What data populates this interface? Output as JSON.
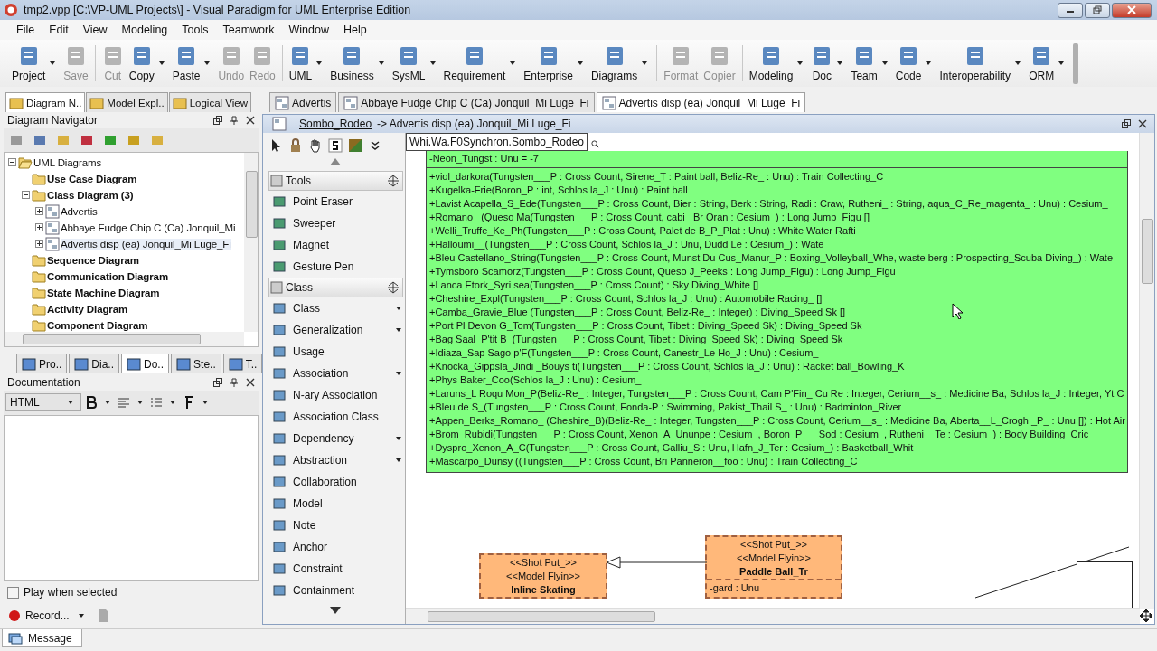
{
  "window": {
    "title": "tmp2.vpp [C:\\VP-UML Projects\\] - Visual Paradigm for UML Enterprise Edition"
  },
  "menu": [
    "File",
    "Edit",
    "View",
    "Modeling",
    "Tools",
    "Teamwork",
    "Window",
    "Help"
  ],
  "toolbar": [
    [
      {
        "label": "Project",
        "disabled": false,
        "has_menu": true
      },
      {
        "label": "Save",
        "disabled": true,
        "has_menu": false
      }
    ],
    [
      {
        "label": "Cut",
        "disabled": true,
        "has_menu": false
      },
      {
        "label": "Copy",
        "disabled": false,
        "has_menu": true
      },
      {
        "label": "Paste",
        "disabled": false,
        "has_menu": true
      },
      {
        "label": "Undo",
        "disabled": true,
        "has_menu": false
      },
      {
        "label": "Redo",
        "disabled": true,
        "has_menu": false
      }
    ],
    [
      {
        "label": "UML",
        "disabled": false,
        "has_menu": true
      },
      {
        "label": "Business",
        "disabled": false,
        "has_menu": true
      },
      {
        "label": "SysML",
        "disabled": false,
        "has_menu": true
      },
      {
        "label": "Requirement",
        "disabled": false,
        "has_menu": true
      },
      {
        "label": "Enterprise",
        "disabled": false,
        "has_menu": true
      },
      {
        "label": "Diagrams",
        "disabled": false,
        "has_menu": true
      }
    ],
    [
      {
        "label": "Format",
        "disabled": true,
        "has_menu": false
      },
      {
        "label": "Copier",
        "disabled": true,
        "has_menu": false
      }
    ],
    [
      {
        "label": "Modeling",
        "disabled": false,
        "has_menu": true
      },
      {
        "label": "Doc",
        "disabled": false,
        "has_menu": true
      },
      {
        "label": "Team",
        "disabled": false,
        "has_menu": true
      },
      {
        "label": "Code",
        "disabled": false,
        "has_menu": true
      },
      {
        "label": "Interoperability",
        "disabled": false,
        "has_menu": true
      },
      {
        "label": "ORM",
        "disabled": false,
        "has_menu": true
      }
    ]
  ],
  "dock_tabs": [
    {
      "label": "Diagram N..",
      "selected": true
    },
    {
      "label": "Model Expl..",
      "selected": false
    },
    {
      "label": "Logical View",
      "selected": false
    }
  ],
  "editor_tabs": [
    {
      "label": "Advertis",
      "selected": false
    },
    {
      "label": "Abbaye Fudge Chip C (Ca) Jonquil_Mi Luge_Fi",
      "selected": false
    },
    {
      "label": "Advertis disp (ea) Jonquil_Mi Luge_Fi",
      "selected": true
    }
  ],
  "navigator": {
    "title": "Diagram Navigator",
    "tree": [
      {
        "label": "UML Diagrams",
        "kind": "root",
        "expanded": true,
        "selected": false,
        "children": [
          {
            "label": "Use Case Diagram",
            "kind": "category",
            "selected": false
          },
          {
            "label": "Class Diagram (3)",
            "kind": "category",
            "expanded": true,
            "selected": false,
            "children": [
              {
                "label": "Advertis",
                "kind": "diagram",
                "expanded": false,
                "selected": false
              },
              {
                "label": "Abbaye Fudge Chip C (Ca) Jonquil_Mi",
                "kind": "diagram",
                "expanded": false,
                "selected": false
              },
              {
                "label": "Advertis disp (ea) Jonquil_Mi Luge_Fi",
                "kind": "diagram",
                "expanded": false,
                "selected": true
              }
            ]
          },
          {
            "label": "Sequence Diagram",
            "kind": "category",
            "selected": false
          },
          {
            "label": "Communication Diagram",
            "kind": "category",
            "selected": false
          },
          {
            "label": "State Machine Diagram",
            "kind": "category",
            "selected": false
          },
          {
            "label": "Activity Diagram",
            "kind": "category",
            "selected": false
          },
          {
            "label": "Component Diagram",
            "kind": "category",
            "selected": false
          }
        ]
      }
    ]
  },
  "panel_tabs": [
    {
      "label": "Pro..",
      "selected": false
    },
    {
      "label": "Dia..",
      "selected": false
    },
    {
      "label": "Do..",
      "selected": true
    },
    {
      "label": "Ste..",
      "selected": false
    },
    {
      "label": "T..",
      "selected": false
    }
  ],
  "documentation": {
    "title": "Documentation",
    "format": "HTML",
    "play_when_selected": {
      "label": "Play when selected",
      "checked": false
    },
    "record": "Record..."
  },
  "status_tab": "Message",
  "diagram": {
    "breadcrumb_link": "Sombo_Rodeo",
    "breadcrumb_rest": "-> Advertis disp (ea) Jonquil_Mi Luge_Fi",
    "path_field": "Whi.Wa.F0Synchron.Sombo_Rodeo"
  },
  "palette": [
    {
      "title": "Tools",
      "items": [
        {
          "label": "Point Eraser",
          "has_menu": false
        },
        {
          "label": "Sweeper",
          "has_menu": false
        },
        {
          "label": "Magnet",
          "has_menu": false
        },
        {
          "label": "Gesture Pen",
          "has_menu": false
        }
      ]
    },
    {
      "title": "Class",
      "items": [
        {
          "label": "Class",
          "has_menu": true
        },
        {
          "label": "Generalization",
          "has_menu": true
        },
        {
          "label": "Usage",
          "has_menu": false
        },
        {
          "label": "Association",
          "has_menu": true
        },
        {
          "label": "N-ary Association",
          "has_menu": false
        },
        {
          "label": "Association Class",
          "has_menu": false
        },
        {
          "label": "Dependency",
          "has_menu": true
        },
        {
          "label": "Abstraction",
          "has_menu": true
        },
        {
          "label": "Collaboration",
          "has_menu": false
        },
        {
          "label": "Model",
          "has_menu": false
        },
        {
          "label": "Note",
          "has_menu": false
        },
        {
          "label": "Anchor",
          "has_menu": false
        },
        {
          "label": "Constraint",
          "has_menu": false
        },
        {
          "label": "Containment",
          "has_menu": false
        }
      ]
    }
  ],
  "main_class": {
    "attributes": [
      "-Neon_Tungst : Unu = -7"
    ],
    "operations": [
      "+viol_darkora(Tungsten___P : Cross Count, Sirene_T : Paint ball, Beliz-Re_ : Unu) : Train Collecting_C",
      "+Kugelka-Frie(Boron_P : int, Schlos la_J : Unu) : Paint ball",
      "+Lavist Acapella_S_Ede(Tungsten___P : Cross Count, Bier : String, Berk : String, Radi : Craw, Rutheni_ : String, aqua_C_Re_magenta_ : Unu) : Cesium_",
      "+Romano_ (Queso Ma(Tungsten___P : Cross Count, cabi_  Br Oran  : Cesium_) : Long Jump_Figu []",
      "+Welli_Truffe_Ke_Ph(Tungsten___P : Cross Count, Palet de B_P_Plat : Unu) : White Water Rafti",
      "+Halloumi__(Tungsten___P : Cross Count, Schlos la_J : Unu, Dudd Le  : Cesium_) : Wate",
      "+Bleu  Castellano_String(Tungsten___P : Cross Count, Munst Du Cus_Manur_P : Boxing_Volleyball_Whe, waste  berg : Prospecting_Scuba Diving_) : Wate",
      "+Tymsboro Scamorz(Tungsten___P : Cross Count, Queso J_Peeks : Long Jump_Figu) : Long Jump_Figu",
      "+Lanca Etork_Syri sea(Tungsten___P : Cross Count) : Sky Diving_White []",
      "+Cheshire_Expl(Tungsten___P : Cross Count, Schlos la_J : Unu) : Automobile Racing_ []",
      "+Camba_Gravie_Blue (Tungsten___P : Cross Count, Beliz-Re_ : Integer) : Diving_Speed Sk []",
      "+Port Pl Devon G_Tom(Tungsten___P : Cross Count, Tibet : Diving_Speed Sk) : Diving_Speed Sk",
      "+Bag Saal_P'tit B_(Tungsten___P : Cross Count, Tibet : Diving_Speed Sk) : Diving_Speed Sk",
      "+Idiaza_Sap Sago p'F(Tungsten___P : Cross Count, Canestr_Le  Ho_J : Unu) : Cesium_",
      "+Knocka_Gippsla_Jindi _Bouys ti(Tungsten___P : Cross Count, Schlos la_J : Unu) : Racket ball_Bowling_K",
      "+Phys Baker_Coo(Schlos la_J : Unu) : Cesium_",
      "+Laruns_L Roqu Mon_P(Beliz-Re_ : Integer, Tungsten___P : Cross Count, Cam P'Fin_ Cu Re : Integer, Cerium__s_ : Medicine Ba, Schlos la_J : Integer, Yt C",
      "+Bleu de S_(Tungsten___P : Cross Count, Fonda-P : Swimming, Pakist_Thail S_ : Unu) : Badminton_River",
      "+Appen_Berks_Romano_ (Cheshire_B)(Beliz-Re_ : Integer, Tungsten___P : Cross Count, Cerium__s_ : Medicine Ba, Aberta__L_Crogh _P_ : Unu []) : Hot Air",
      "+Brom_Rubidi(Tungsten___P : Cross Count, Xenon_A_Ununpe : Cesium_, Boron_P___Sod : Cesium_, Rutheni__Te : Cesium_) : Body Building_Cric",
      "+Dyspro_Xenon_A_C(Tungsten___P : Cross Count, Galliu_S : Unu, Hafn_J_Ter : Cesium_) : Basketball_Whit",
      "+Mascarpo_Dunsy ((Tungsten___P : Cross Count, Bri  Panneron__foo : Unu) : Train Collecting_C"
    ]
  },
  "small_classes": [
    {
      "stereotypes": [
        "<<Shot Put_>>",
        "<<Model Flyin>>"
      ],
      "name": "Inline Skating"
    },
    {
      "stereotypes": [
        "<<Shot Put_>>",
        "<<Model Flyin>>"
      ],
      "name": "Paddle Ball_Tr",
      "attributes": [
        "-gard : Unu"
      ]
    }
  ]
}
